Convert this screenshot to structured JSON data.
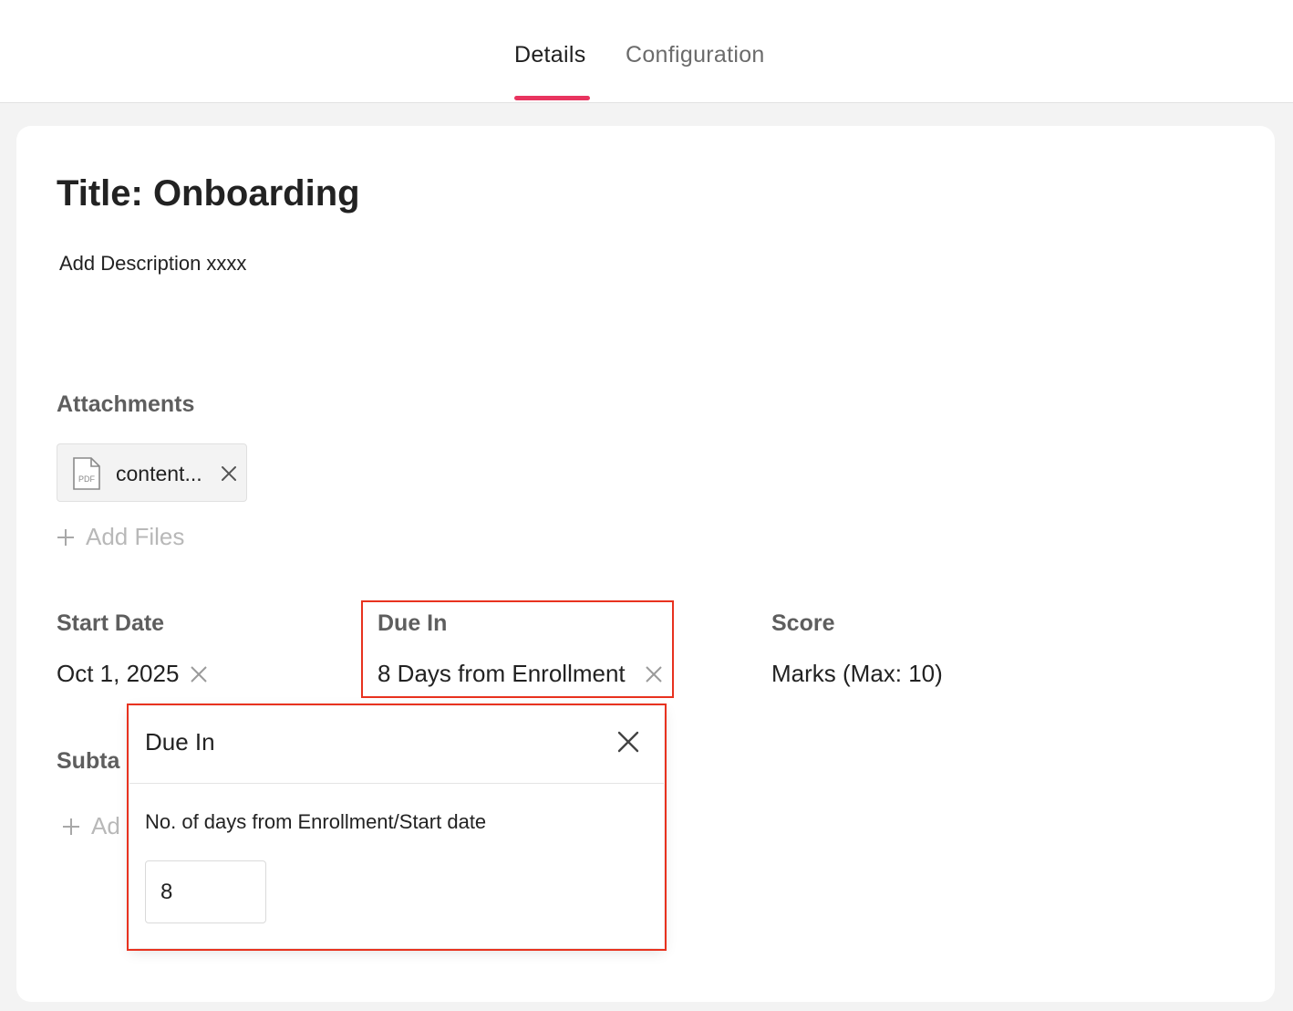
{
  "tabs": [
    {
      "label": "Details",
      "active": true
    },
    {
      "label": "Configuration",
      "active": false
    }
  ],
  "accent_color": "#e8345f",
  "annotation_color": "#e8321f",
  "task": {
    "title": "Title: Onboarding",
    "description": "Add Description xxxx"
  },
  "attachments": {
    "label": "Attachments",
    "files": [
      {
        "name": "content...",
        "type_badge": "PDF",
        "icon": "pdf-file-icon"
      }
    ],
    "add_label": "Add Files"
  },
  "fields": {
    "start_date": {
      "label": "Start Date",
      "value": "Oct 1, 2025"
    },
    "due_in": {
      "label": "Due In",
      "value": "8 Days from Enrollment"
    },
    "score": {
      "label": "Score",
      "value": "Marks (Max: 10)"
    }
  },
  "subtasks": {
    "label_partial": "Subta",
    "add_partial": "Ad"
  },
  "due_popup": {
    "title": "Due In",
    "field_label": "No. of days from Enrollment/Start date",
    "value": "8"
  }
}
